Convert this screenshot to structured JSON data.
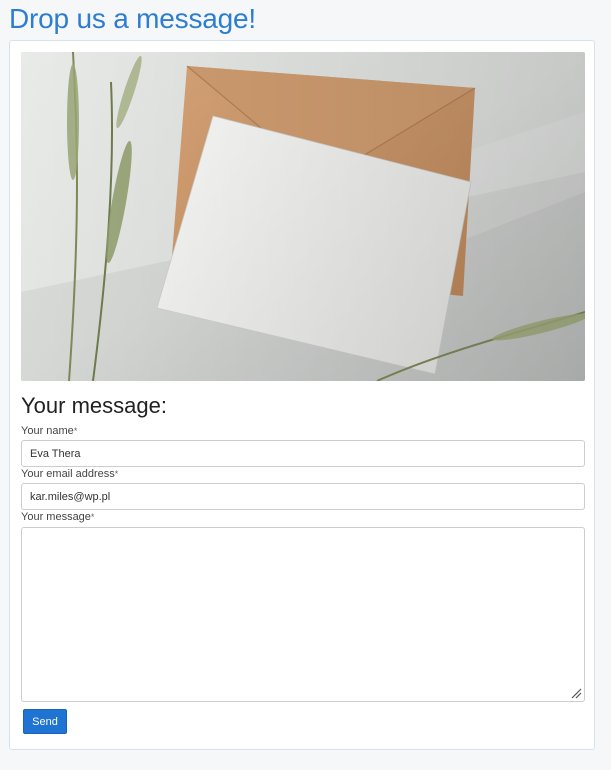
{
  "page": {
    "title": "Drop us a message!"
  },
  "form": {
    "heading": "Your message:",
    "name": {
      "label": "Your name",
      "required_mark": "*",
      "value": "Eva Thera"
    },
    "email": {
      "label": "Your email address",
      "required_mark": "*",
      "value": "kar.miles@wp.pl"
    },
    "message": {
      "label": "Your message",
      "required_mark": "*",
      "value": ""
    },
    "send_label": "Send"
  },
  "colors": {
    "title": "#2d7dd2",
    "button": "#1f73d2",
    "card_border": "#d6e3ee",
    "background": "#f5f7f9"
  },
  "icons": {
    "textarea_resize": "resize-grip-icon"
  }
}
